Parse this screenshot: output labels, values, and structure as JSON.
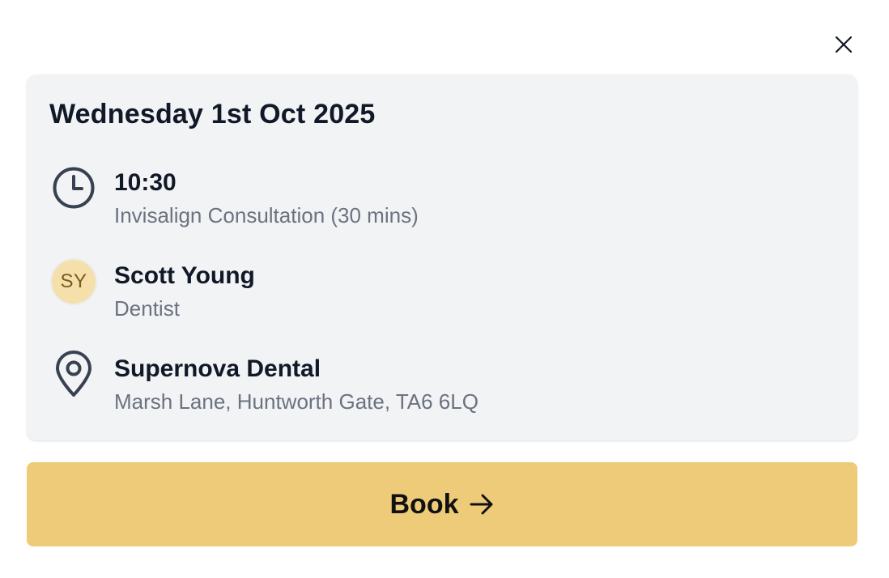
{
  "dialog": {
    "close_icon": "close-icon"
  },
  "appointment": {
    "date": "Wednesday 1st Oct 2025",
    "time": {
      "icon": "clock-icon",
      "title": "10:30",
      "subtitle": "Invisalign Consultation (30 mins)"
    },
    "practitioner": {
      "initials": "SY",
      "name": "Scott Young",
      "role": "Dentist",
      "avatar_color": "#f5dfaa"
    },
    "location": {
      "icon": "map-pin-icon",
      "name": "Supernova Dental",
      "address": "Marsh Lane, Huntworth Gate, TA6 6LQ"
    }
  },
  "actions": {
    "book_label": "Book",
    "book_icon": "arrow-right-icon",
    "book_color": "#edcb78"
  }
}
